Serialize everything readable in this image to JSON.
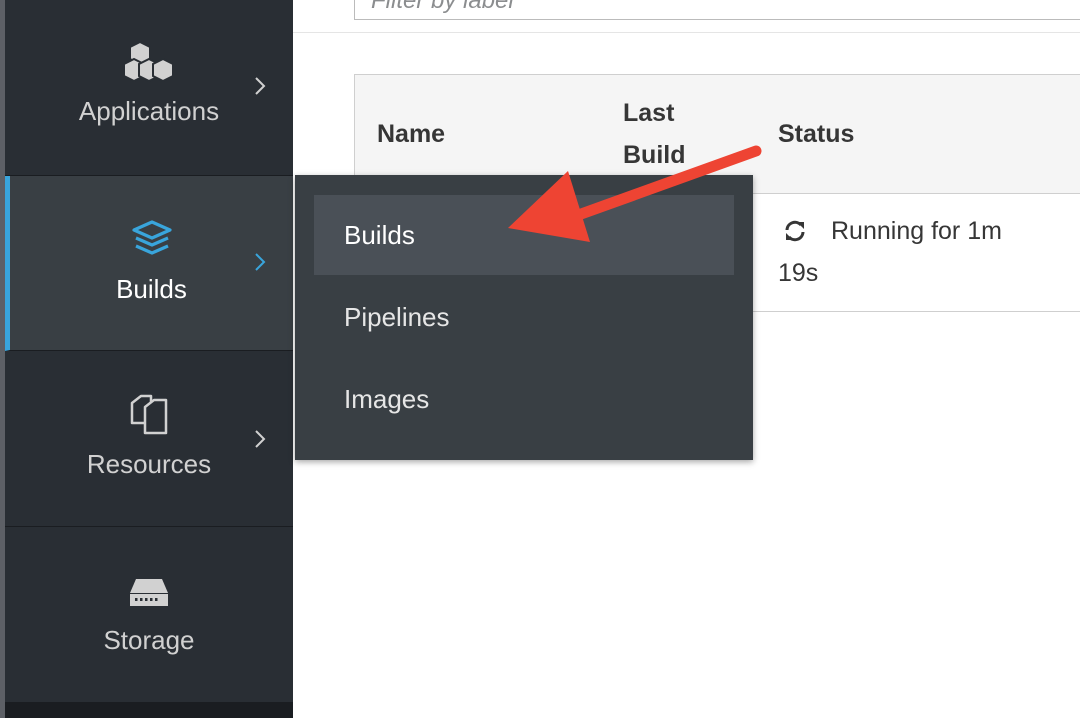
{
  "filter": {
    "placeholder": "Filter by label"
  },
  "sidebar": {
    "items": [
      {
        "label": "Applications",
        "icon": "cubes-icon"
      },
      {
        "label": "Builds",
        "icon": "layers-icon",
        "active": true
      },
      {
        "label": "Resources",
        "icon": "files-icon"
      },
      {
        "label": "Storage",
        "icon": "storage-icon"
      }
    ]
  },
  "table": {
    "headers": {
      "name": "Name",
      "last_build_line1": "Last",
      "last_build_line2": "Build",
      "status": "Status"
    },
    "row": {
      "status_line1": "Running for 1m",
      "status_line2": "19s"
    }
  },
  "flyout": {
    "items": [
      {
        "label": "Builds"
      },
      {
        "label": "Pipelines"
      },
      {
        "label": "Images"
      }
    ]
  },
  "colors": {
    "accent": "#39a5dc",
    "arrow": "#ee4433",
    "sidebar_bg": "#292e34",
    "menu_bg": "#393f44"
  }
}
